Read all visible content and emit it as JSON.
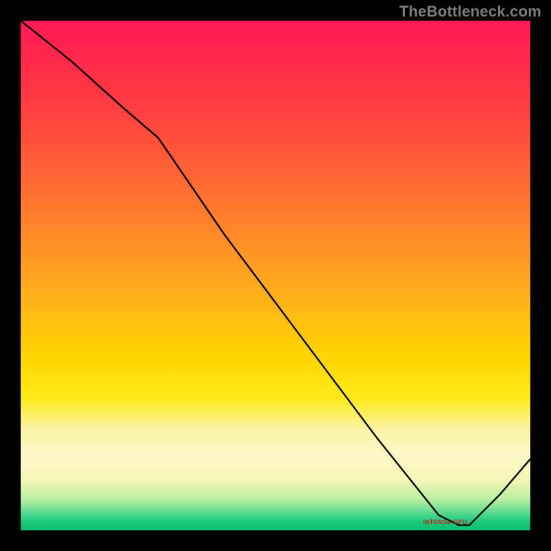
{
  "watermark": "TheBottleneck.com",
  "accent_color_red": "#c81e28",
  "gradient_top_color": "#ff1a55",
  "gradient_bottom_color": "#0fbf72",
  "annotation_label": "INTENSE GPU",
  "chart_data": {
    "type": "line",
    "title": "",
    "xlabel": "",
    "ylabel": "",
    "xlim": [
      0,
      100
    ],
    "ylim": [
      0,
      100
    ],
    "grid": false,
    "series": [
      {
        "name": "curve",
        "x": [
          0,
          10,
          20,
          27,
          40,
          55,
          70,
          78,
          82,
          86,
          88,
          94,
          100
        ],
        "values": [
          100,
          92,
          83,
          77,
          58,
          38,
          18,
          8,
          3,
          1,
          1,
          7,
          14
        ]
      }
    ],
    "annotations": [
      {
        "text_ref": "annotation_label",
        "x": 83,
        "y": 1.5
      }
    ]
  }
}
